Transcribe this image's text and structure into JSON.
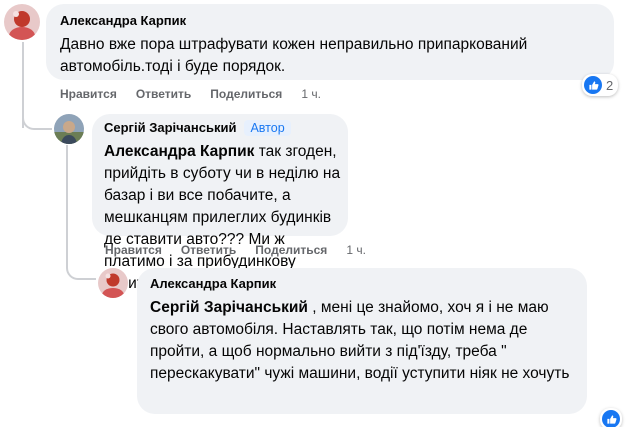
{
  "comments": [
    {
      "author": "Александра Карпик",
      "text": "Давно вже пора штрафувати кожен неправильно припаркований автомобіль.тоді і буде порядок.",
      "actions": {
        "like": "Нравится",
        "reply": "Ответить",
        "share": "Поделиться",
        "time": "1 ч."
      },
      "reaction_count": "2",
      "reaction_icon": "like-icon"
    },
    {
      "author": "Сергій Зарічанський",
      "badge": "Автор",
      "mention": "Александра Карпик",
      "text": " так згоден, прийдіть в суботу чи в неділю на базар і ви все побачите, а мешканцям прилеглих будинків де ставити авто??? Ми ж платимо і за прибудинкову територію і дорожній збір!!!",
      "actions": {
        "like": "Нравится",
        "reply": "Ответить",
        "share": "Поделиться",
        "time": "1 ч."
      }
    },
    {
      "author": "Александра Карпик",
      "mention": "Сергій Зарічанський",
      "text": " , мені це знайомо, хоч я і не маю свого автомобіля. Наставлять так, що потім нема де пройти, а щоб нормально вийти з під'їзду, треба \" перескакувати\" чужі машини, водії уступити ніяк не хочуть"
    }
  ],
  "colors": {
    "bubble": "#f0f2f5",
    "accent": "#1877f2",
    "muted": "#65676b"
  }
}
